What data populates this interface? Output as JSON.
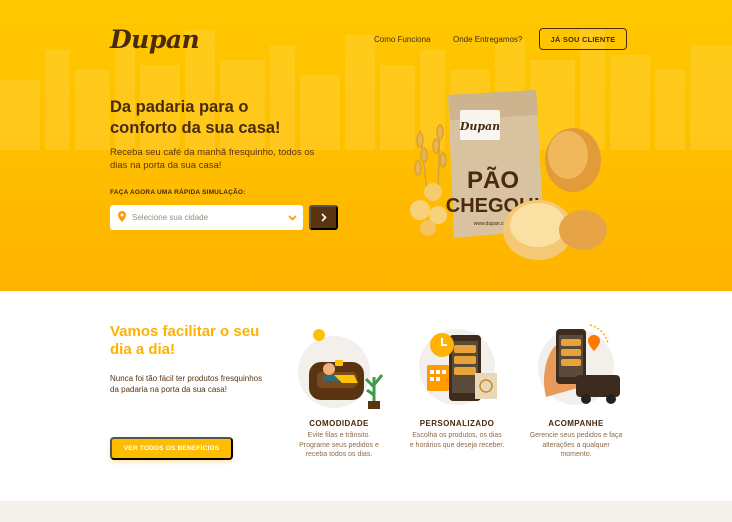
{
  "brand": {
    "logo_text": "Dupan",
    "primary": "#ffbd00",
    "dark": "#4a2a0c"
  },
  "nav": {
    "links": [
      "Como Funciona",
      "Onde Entregamos?"
    ],
    "cta": "JÁ SOU CLIENTE"
  },
  "hero": {
    "title": "Da padaria para o conforto da sua casa!",
    "subtitle": "Receba seu café da manhã fresquinho, todos os dias na porta da sua casa!",
    "simulation_label": "FAÇA AGORA UMA RÁPIDA SIMULAÇÃO:",
    "city_select": {
      "placeholder": "Selecione sua cidade",
      "icons": [
        "location-pin-icon",
        "chevron-down-icon"
      ]
    },
    "go_button_icon": "chevron-right-icon",
    "bag": {
      "brand": "Dupan",
      "line1": "PÃO",
      "line2": "CHEGOU!",
      "url": "www.dupan.co"
    }
  },
  "benefits": {
    "title": "Vamos facilitar o seu dia a dia!",
    "text": "Nunca foi tão fácil ter produtos fresquinhos da padaria na porta da sua casa!",
    "button": "VER TODOS OS BENEFÍCIOS",
    "items": [
      {
        "title": "COMODIDADE",
        "desc": "Evite filas e trânsito. Programe seus pedidos e receba todos os dias.",
        "icon": "person-relaxing-icon"
      },
      {
        "title": "PERSONALIZADO",
        "desc": "Escolha os produtos, os dias e horários que deseja receber.",
        "icon": "phone-calendar-icon"
      },
      {
        "title": "ACOMPANHE",
        "desc": "Gerencie seus pedidos e faça alterações a qualquer momento.",
        "icon": "delivery-tracking-icon"
      }
    ]
  }
}
